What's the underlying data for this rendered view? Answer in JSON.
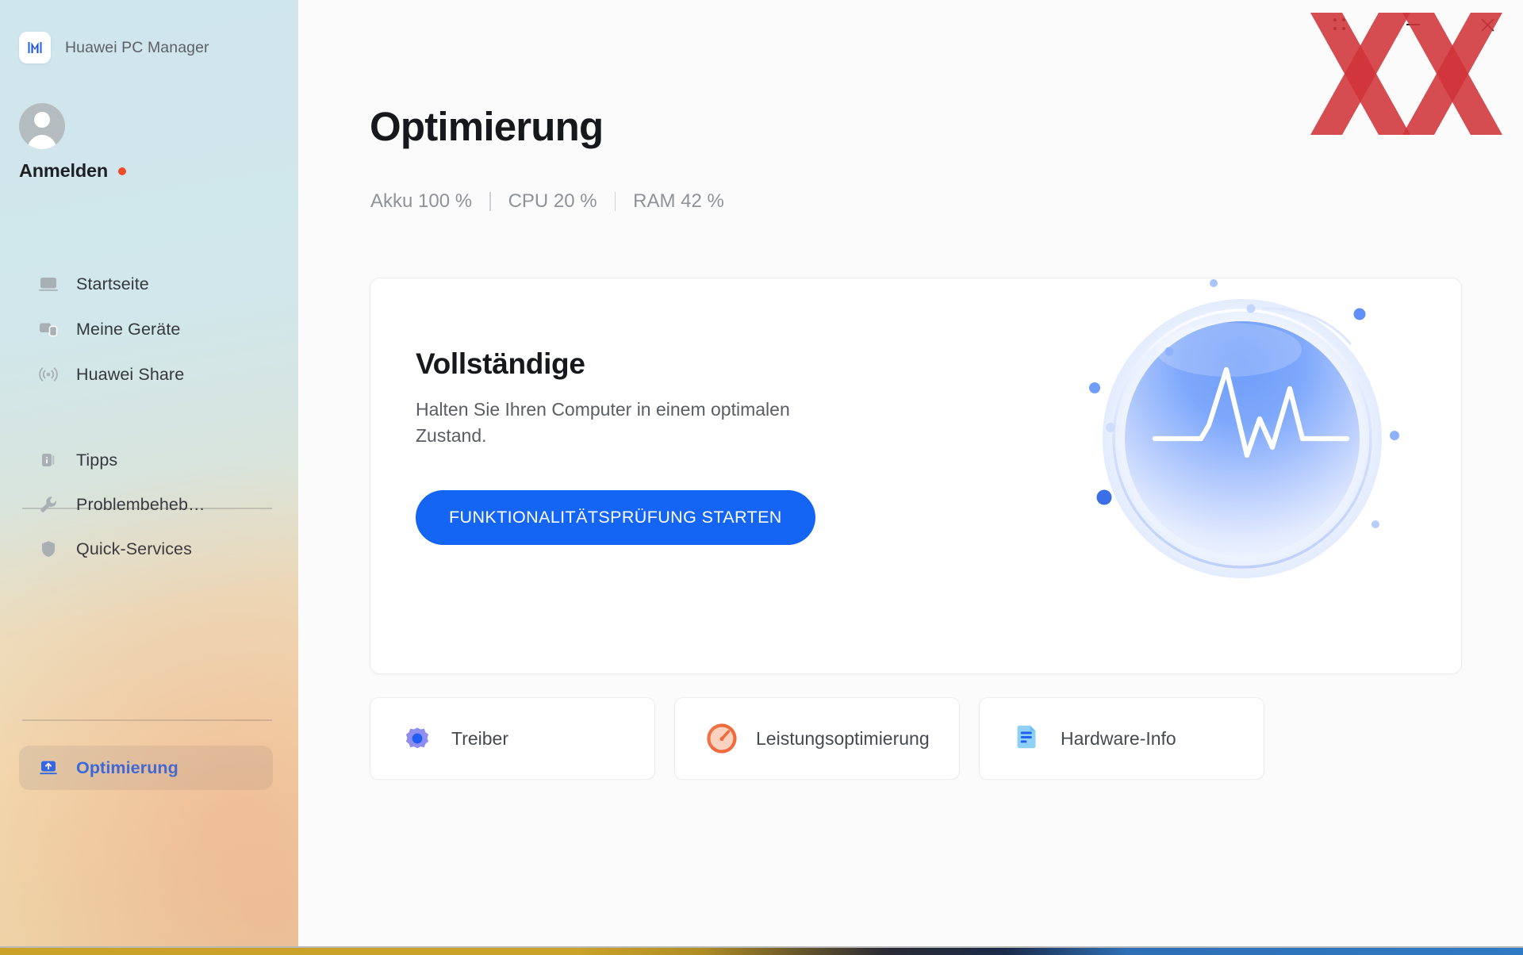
{
  "app": {
    "name": "Huawei PC Manager",
    "logo_icon": "huawei-pc-manager-logo-icon"
  },
  "account": {
    "sign_in_label": "Anmelden",
    "avatar_icon": "avatar-icon",
    "notification_dot_color": "#ef4b2b"
  },
  "sidebar": {
    "groups": [
      {
        "items": [
          {
            "label": "Startseite",
            "icon": "monitor-icon",
            "active": false
          },
          {
            "label": "Meine Geräte",
            "icon": "devices-icon",
            "active": false
          },
          {
            "label": "Huawei Share",
            "icon": "wireless-share-icon",
            "active": false
          }
        ]
      },
      {
        "items": [
          {
            "label": "Tipps",
            "icon": "info-card-icon",
            "active": false
          },
          {
            "label": "Problembeheb…",
            "icon": "wrench-icon",
            "active": false
          },
          {
            "label": "Quick-Services",
            "icon": "shield-icon",
            "active": false
          }
        ]
      },
      {
        "items": [
          {
            "label": "Optimierung",
            "icon": "optimize-upload-icon",
            "active": true
          }
        ]
      }
    ]
  },
  "header": {
    "title": "Optimierung",
    "stats": [
      {
        "label": "Akku",
        "value": "100 %",
        "text": "Akku 100 %"
      },
      {
        "label": "CPU",
        "value": "20 %",
        "text": "CPU 20 %"
      },
      {
        "label": "RAM",
        "value": "42 %",
        "text": "RAM 42 %"
      }
    ],
    "separator": "|"
  },
  "hero": {
    "title": "Vollständige",
    "description": "Halten Sie Ihren Computer in einem optimalen Zustand.",
    "button_label": "FUNKTIONALITÄTSPRÜFUNG STARTEN",
    "button_color": "#1565f5",
    "illustration_icon": "health-pulse-orb-icon"
  },
  "tiles": [
    {
      "label": "Treiber",
      "icon": "gear-icon",
      "icon_color": "#8f8df0"
    },
    {
      "label": "Leistungsoptimierung",
      "icon": "speedometer-icon",
      "icon_color": "#ef6b3e"
    },
    {
      "label": "Hardware-Info",
      "icon": "document-info-icon",
      "icon_color": "#74c4f2"
    }
  ],
  "window_controls": {
    "grid_icon": "app-grid-icon",
    "minimize_icon": "minimize-icon",
    "close_icon": "close-icon"
  },
  "watermark": {
    "name": "hardwareluxx-xx-watermark",
    "color": "#cf3339"
  }
}
